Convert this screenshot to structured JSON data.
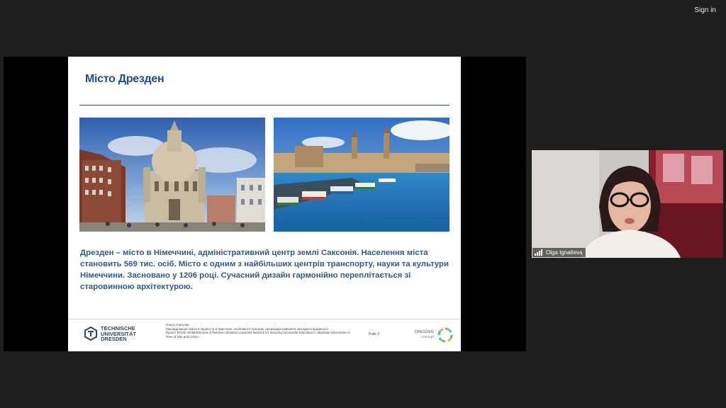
{
  "topbar": {
    "sign_in_label": "Sign in"
  },
  "slide": {
    "title": "Місто Дрезден",
    "body": "Дрезден – місто в Німеччині, адміністративний центр землі Саксонія. Населення міста становить 569 тис. осіб. Місто є одним з найбільших центрів транспорту, науки та культури Німеччини. Засновано у 1206 році. Сучасний дизайн гармонійно переплітається зі старовинною архітектурою.",
    "footer": {
      "tu_logo_text": [
        "TECHNISCHE",
        "UNIVERSITÄT",
        "DRESDEN"
      ],
      "author": "Ольга Ігнатьєва",
      "course": "Заклади вищої освіти в Україні та в Німеччині: особливості програм, організація навчання, методичні відмінності",
      "project": "Проект DAAD «Establishment of German-Ukrainian University Network for Securing Successful Education in Ukrainian Universities in Time of War and Crisis»",
      "page_label": "Folie 3",
      "dresden_logo_main": "DRESDEN",
      "dresden_logo_sub": "concept"
    }
  },
  "participant": {
    "name": "Olga Ignatieva"
  },
  "colors": {
    "background": "#1e1e1e",
    "title": "#1e4e8c",
    "body_text": "#2e5b94"
  }
}
